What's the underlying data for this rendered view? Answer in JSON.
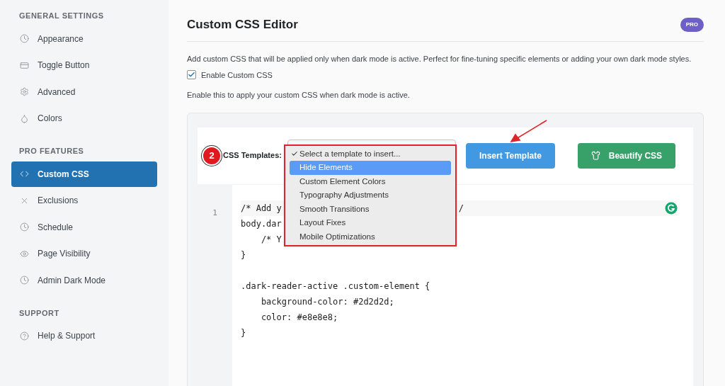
{
  "sidebar": {
    "sections": [
      {
        "heading": "GENERAL SETTINGS",
        "items": [
          {
            "label": "Appearance",
            "selected": false
          },
          {
            "label": "Toggle Button",
            "selected": false
          },
          {
            "label": "Advanced",
            "selected": false
          },
          {
            "label": "Colors",
            "selected": false
          }
        ]
      },
      {
        "heading": "PRO FEATURES",
        "items": [
          {
            "label": "Custom CSS",
            "selected": true
          },
          {
            "label": "Exclusions",
            "selected": false
          },
          {
            "label": "Schedule",
            "selected": false
          },
          {
            "label": "Page Visibility",
            "selected": false
          },
          {
            "label": "Admin Dark Mode",
            "selected": false
          }
        ]
      },
      {
        "heading": "SUPPORT",
        "items": [
          {
            "label": "Help & Support",
            "selected": false
          }
        ]
      }
    ]
  },
  "main": {
    "title": "Custom CSS Editor",
    "badge": "PRO",
    "description": "Add custom CSS that will be applied only when dark mode is active. Perfect for fine-tuning specific elements or adding your own dark mode styles.",
    "enable": {
      "label": "Enable Custom CSS",
      "checked": true
    },
    "hint": "Enable this to apply your custom CSS when dark mode is active.",
    "editor": {
      "step": "2",
      "templates_label": "CSS Templates:",
      "dropdown": {
        "options": [
          {
            "label": "Select a template to insert...",
            "checked": true,
            "selected": false
          },
          {
            "label": "Hide Elements",
            "checked": false,
            "selected": true
          },
          {
            "label": "Custom Element Colors",
            "checked": false,
            "selected": false
          },
          {
            "label": "Typography Adjustments",
            "checked": false,
            "selected": false
          },
          {
            "label": "Smooth Transitions",
            "checked": false,
            "selected": false
          },
          {
            "label": "Layout Fixes",
            "checked": false,
            "selected": false
          },
          {
            "label": "Mobile Optimizations",
            "checked": false,
            "selected": false
          }
        ]
      },
      "buttons": [
        "Insert Template",
        "Beautify CSS"
      ],
      "line_number": "1",
      "code": [
        {
          "text": "/* Add y",
          "tail": "/"
        },
        {
          "text": "body.dar"
        },
        {
          "text": "    /* Y"
        },
        {
          "text": "}"
        },
        {
          "kind": "blank"
        },
        {
          "text": ".dark-reader-active .custom-element {"
        },
        {
          "text": "    background-color: #2d2d2d;"
        },
        {
          "text": "    color: #e8e8e8;"
        },
        {
          "text": "}"
        }
      ]
    }
  }
}
